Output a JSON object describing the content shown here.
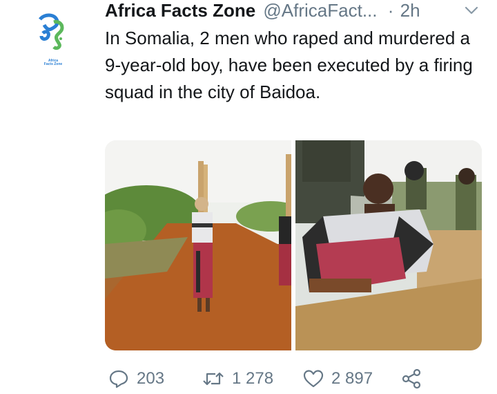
{
  "account": {
    "name": "Africa Facts Zone",
    "handle": "@AfricaFact...",
    "separator": "·",
    "time": "2h",
    "avatar_brand_line1": "Africa",
    "avatar_brand_line2": "Facts Zone"
  },
  "tweet": {
    "text": "In Somalia, 2 men who raped and murdered a 9-year-old boy, have been executed by a firing squad in the city of Baidoa."
  },
  "media": {
    "photos": [
      {
        "description_icon": "photo-man-tied-to-pole"
      },
      {
        "description_icon": "photo-man-seated-by-box"
      }
    ]
  },
  "actions": {
    "replies": "203",
    "retweets": "1 278",
    "likes": "2 897"
  },
  "colors": {
    "text": "#14171a",
    "secondary": "#657786",
    "brand_blue": "#2a7fd4",
    "brand_green": "#5cb85c"
  }
}
